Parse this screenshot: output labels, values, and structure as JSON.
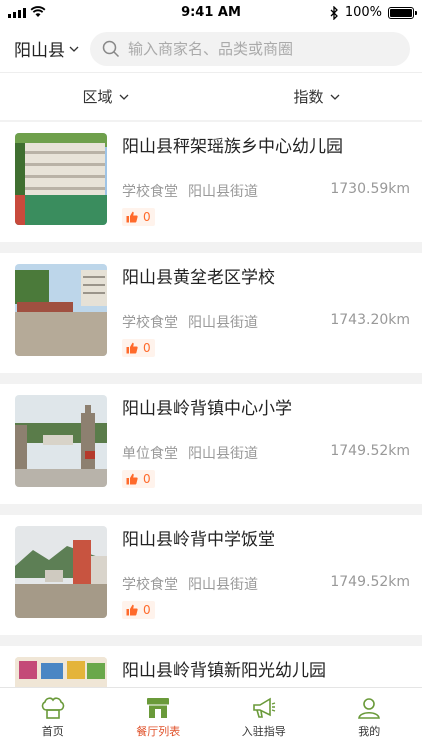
{
  "status_bar": {
    "time": "9:41 AM",
    "battery": "100%"
  },
  "header": {
    "location": "阳山县",
    "search_placeholder": "输入商家名、品类或商圈"
  },
  "filters": [
    {
      "label": "区域"
    },
    {
      "label": "指数"
    }
  ],
  "restaurants": [
    {
      "name": "阳山县秤架瑶族乡中心幼儿园",
      "category": "学校食堂",
      "area": "阳山县街道",
      "distance": "1730.59km",
      "likes": "0"
    },
    {
      "name": "阳山县黄坌老区学校",
      "category": "学校食堂",
      "area": "阳山县街道",
      "distance": "1743.20km",
      "likes": "0"
    },
    {
      "name": "阳山县岭背镇中心小学",
      "category": "单位食堂",
      "area": "阳山县街道",
      "distance": "1749.52km",
      "likes": "0"
    },
    {
      "name": "阳山县岭背中学饭堂",
      "category": "学校食堂",
      "area": "阳山县街道",
      "distance": "1749.52km",
      "likes": "0"
    },
    {
      "name": "阳山县岭背镇新阳光幼儿园",
      "category": "",
      "area": "",
      "distance": "",
      "likes": ""
    }
  ],
  "tabbar": [
    {
      "label": "首页",
      "icon": "chef-hat-icon"
    },
    {
      "label": "餐厅列表",
      "icon": "storefront-icon"
    },
    {
      "label": "入驻指导",
      "icon": "megaphone-icon"
    },
    {
      "label": "我的",
      "icon": "user-icon"
    }
  ],
  "colors": {
    "accent": "#e0532c",
    "green": "#6a9a3a",
    "like": "#ff6a2b"
  }
}
